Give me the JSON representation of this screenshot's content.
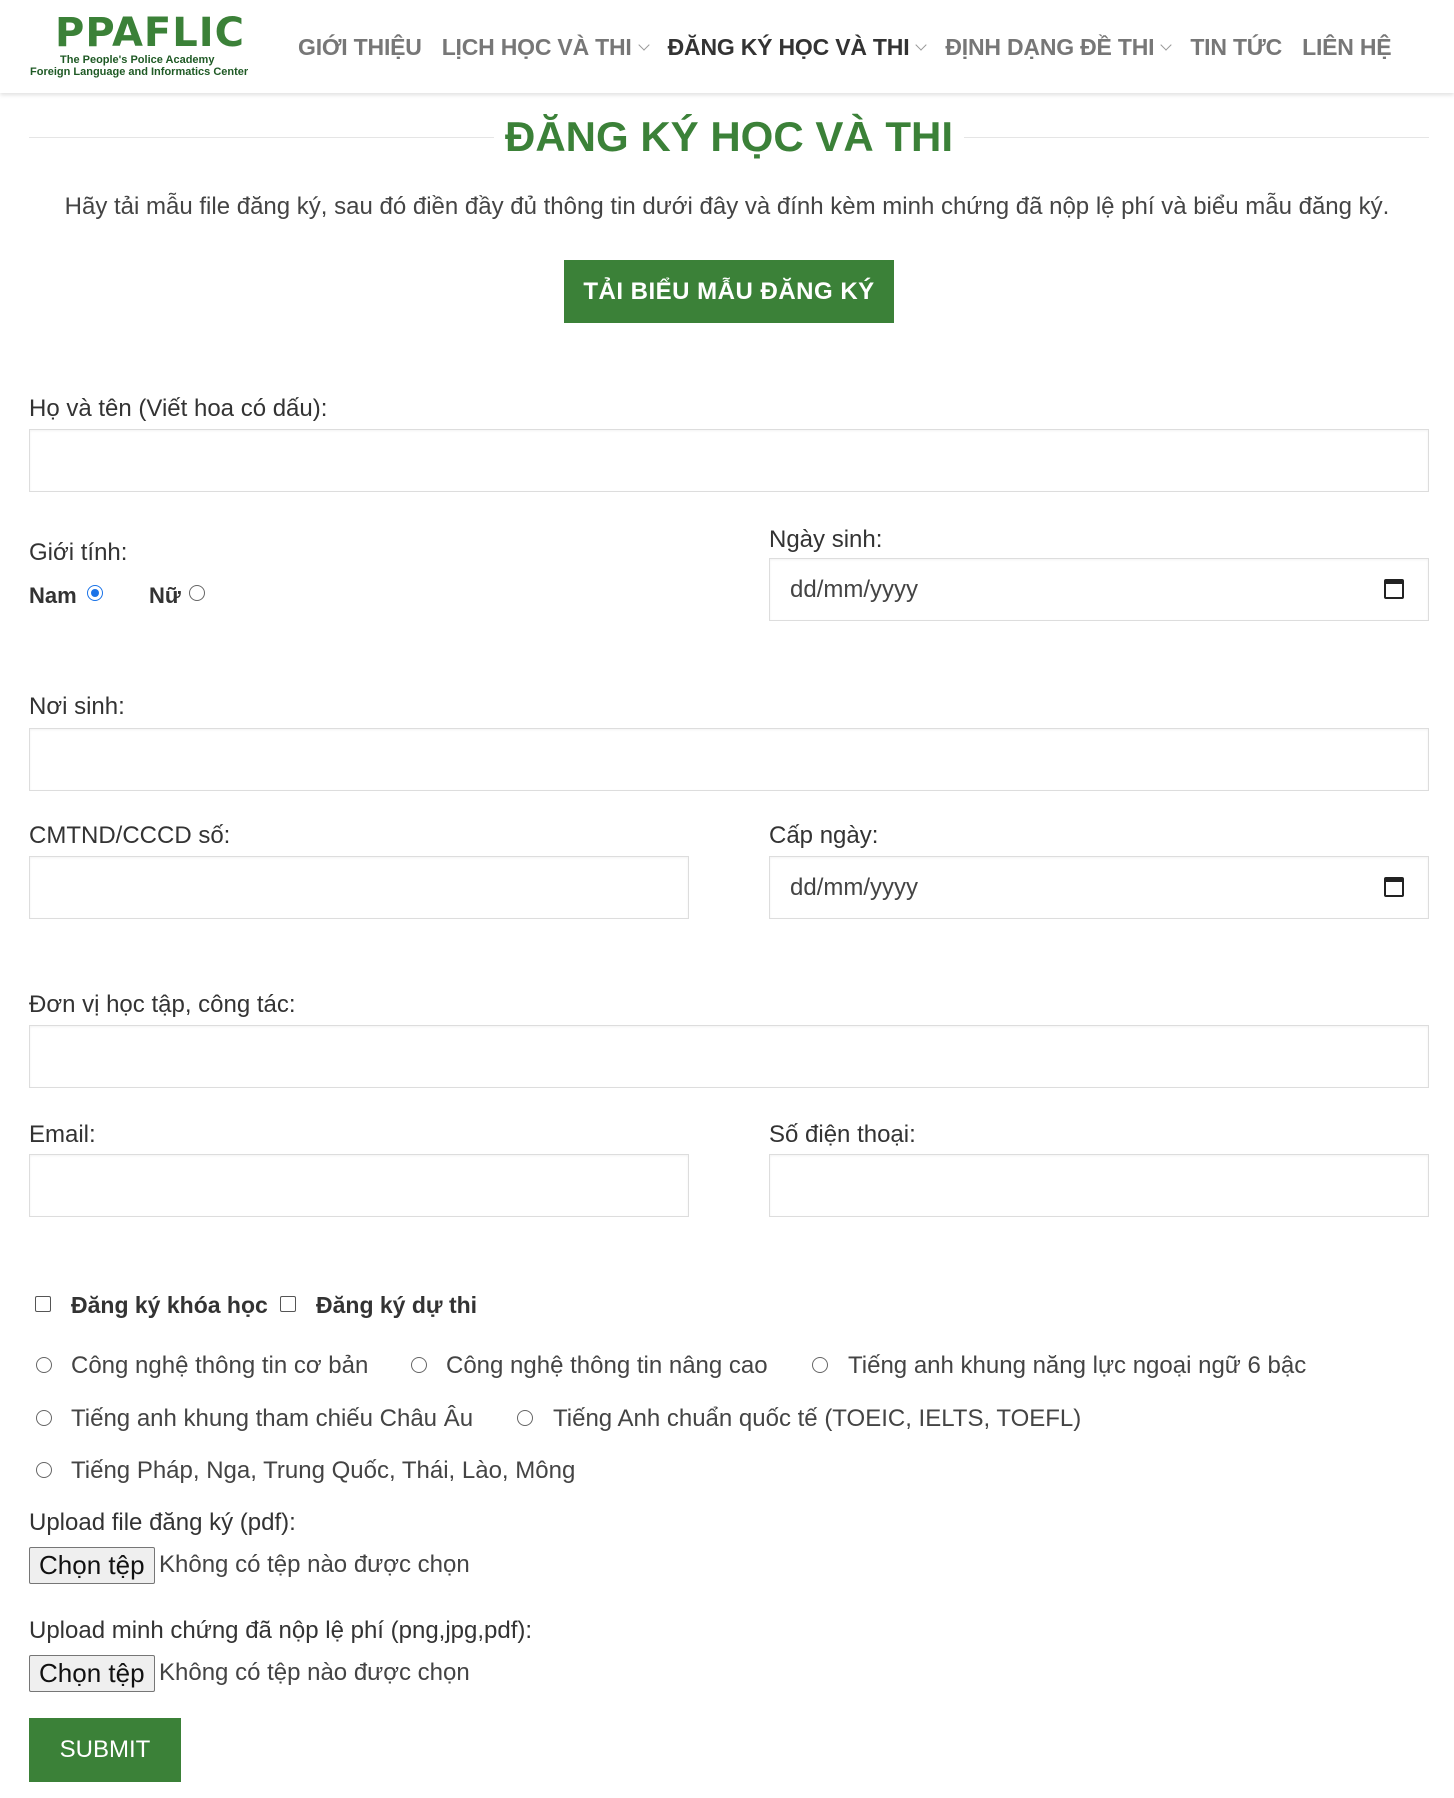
{
  "logo": {
    "main": "PPAFLIC",
    "sub1": "The People's Police Academy",
    "sub2": "Foreign Language and Informatics Center"
  },
  "nav": {
    "items": [
      {
        "label": "GIỚI THIỆU"
      },
      {
        "label": "LỊCH HỌC VÀ THI"
      },
      {
        "label": "ĐĂNG KÝ HỌC VÀ THI"
      },
      {
        "label": "ĐỊNH DẠNG ĐỀ THI"
      },
      {
        "label": "TIN TỨC"
      },
      {
        "label": "LIÊN HỆ"
      }
    ]
  },
  "page": {
    "title": "ĐĂNG KÝ HỌC VÀ THI",
    "intro": "Hãy tải mẫu file đăng ký, sau đó điền đầy đủ thông tin dưới đây và đính kèm minh chứng đã nộp lệ phí và biểu mẫu đăng ký.",
    "download_button": "TẢI BIỂU MẪU ĐĂNG KÝ"
  },
  "form": {
    "fullname_label": "Họ và tên (Viết hoa có dấu):",
    "gender_label": "Giới tính:",
    "gender_male": "Nam",
    "gender_female": "Nữ",
    "dob_label": "Ngày sinh:",
    "dob_placeholder": "dd/mm/yyyy",
    "birthplace_label": "Nơi sinh:",
    "id_label": "CMTND/CCCD số:",
    "issue_date_label": "Cấp ngày:",
    "issue_date_placeholder": "dd/mm/yyyy",
    "workplace_label": "Đơn vị học tập, công tác:",
    "email_label": "Email:",
    "phone_label": "Số điện thoại:",
    "register_course": "Đăng ký khóa học",
    "register_exam": "Đăng ký dự thi",
    "options": [
      "Công nghệ thông tin cơ bản",
      "Công nghệ thông tin nâng cao",
      "Tiếng anh khung năng lực ngoại ngữ 6 bậc",
      "Tiếng anh khung tham chiếu Châu Âu",
      "Tiếng Anh chuẩn quốc tế (TOEIC, IELTS, TOEFL)",
      "Tiếng Pháp, Nga, Trung Quốc, Thái, Lào, Mông"
    ],
    "upload_form_label": "Upload file đăng ký (pdf):",
    "upload_fee_label": "Upload minh chứng đã nộp lệ phí (png,jpg,pdf):",
    "choose_file": "Chọn tệp",
    "no_file": "Không có tệp nào được chọn",
    "submit": "SUBMIT"
  },
  "colors": {
    "brand_green": "#3b8138",
    "radio_blue": "#1a73e8"
  }
}
